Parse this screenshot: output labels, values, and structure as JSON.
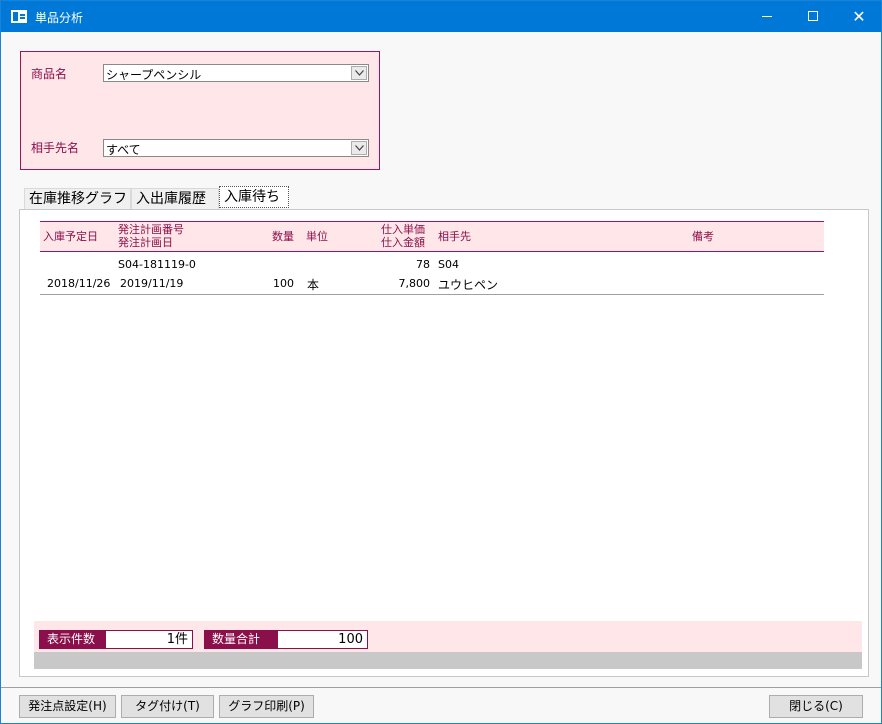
{
  "window": {
    "title": "単品分析",
    "minimize": "—",
    "close": "✕"
  },
  "filters": {
    "product_label": "商品名",
    "product_value": "シャープペンシル",
    "partner_label": "相手先名",
    "partner_value": "すべて"
  },
  "tabs": [
    {
      "label": "在庫推移グラフ"
    },
    {
      "label": "入出庫履歴"
    },
    {
      "label": "入庫待ち"
    }
  ],
  "grid": {
    "headers": {
      "planned_date": "入庫予定日",
      "order_no": "発注計画番号",
      "order_date": "発注計画日",
      "qty": "数量",
      "unit": "単位",
      "unit_price": "仕入単価",
      "amount": "仕入金額",
      "partner": "相手先",
      "note": "備考"
    },
    "rows": [
      {
        "order_no": "S04-181119-0",
        "unit_price": "78",
        "partner_code": "S04",
        "planned_date": "2018/11/26",
        "order_date": "2019/11/19",
        "qty": "100",
        "unit": "本",
        "amount": "7,800",
        "partner_name": "ユウヒペン"
      }
    ]
  },
  "summary": {
    "count_label": "表示件数",
    "count_value": "1件",
    "qty_total_label": "数量合計",
    "qty_total_value": "100"
  },
  "buttons": {
    "order_point": "発注点設定(H)",
    "tagging": "タグ付け(T)",
    "graph_print": "グラフ印刷(P)",
    "close": "閉じる(C)"
  },
  "colors": {
    "titlebar": "#0078d7",
    "accent": "#8b0f4a",
    "panel_bg": "#ffe6e9"
  }
}
